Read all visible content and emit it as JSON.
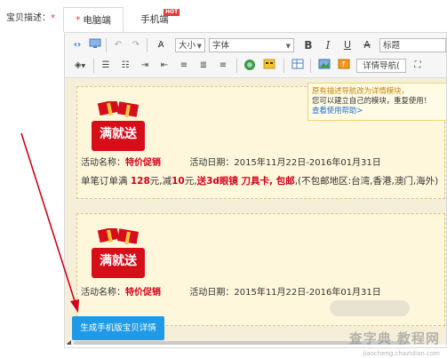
{
  "field": {
    "label": "宝贝描述：",
    "required_mark": "*"
  },
  "tabs": [
    {
      "label": "电脑端",
      "star": "*",
      "active": true
    },
    {
      "label": "手机端",
      "badge": "HOT",
      "active": false
    }
  ],
  "toolbar": {
    "size_select": "大小",
    "font_select": "字体",
    "bold": "B",
    "italic": "I",
    "underline": "U",
    "strike": "A",
    "heading_select": "标题",
    "detail_nav_button": "详情导航(",
    "icons": [
      "source-code-icon",
      "screen-icon",
      "undo-icon",
      "redo-icon",
      "clear-format-icon",
      "text-color-icon",
      "fill-color-icon",
      "unordered-list-icon",
      "ordered-list-icon",
      "indent-icon",
      "outdent-icon",
      "align-left-icon",
      "align-center-icon",
      "align-right-icon",
      "link-icon",
      "emoji-icon",
      "table-icon",
      "image-icon",
      "flash-icon",
      "fullscreen-icon"
    ]
  },
  "tooltip": {
    "line1": "原有描述导航改为详情模块，",
    "line2": "您可以建立自己的模块，重复使用！",
    "link": "查看使用帮助>"
  },
  "promos": [
    {
      "badge": "满就送",
      "name_label": "活动名称：",
      "name_value": "特价促销",
      "date_label": "活动日期：",
      "date_value": "2015年11月22日-2016年01月31日",
      "detail_pre": "单笔订单满",
      "amount": "128",
      "detail_mid1": "元,减",
      "discount": "10",
      "detail_mid2": "元,",
      "gift": "送3d眼镜 刀具卡, 包邮",
      "detail_post": ",(不包邮地区:台湾,香港,澳门,海外)"
    },
    {
      "badge": "满就送",
      "name_label": "活动名称：",
      "name_value": "特价促销",
      "date_label": "活动日期：",
      "date_value": "2015年11月22日-2016年01月31日"
    }
  ],
  "generate_button": "生成手机版宝贝详情",
  "watermark": {
    "text": "查字典 教程网",
    "url": "jiaocheng.chazidian.com"
  },
  "colors": {
    "accent_blue": "#1f9ae8",
    "promo_red": "#d0021b",
    "content_bg": "#f5efda"
  }
}
